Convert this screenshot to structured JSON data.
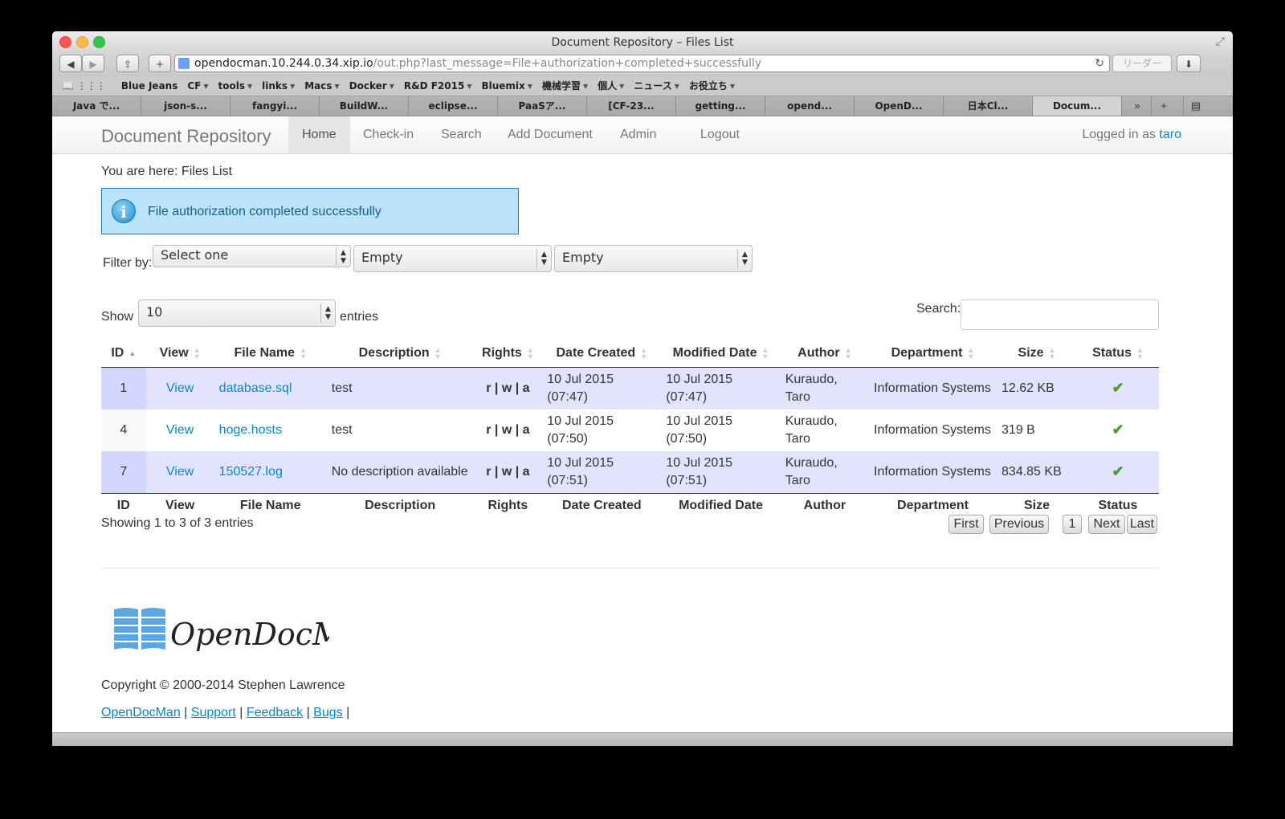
{
  "window": {
    "title": "Document Repository – Files List"
  },
  "toolbar": {
    "url_host": "opendocman.10.244.0.34.xip.io",
    "url_path": "/out.php?last_message=File+authorization+completed+successfully",
    "reader_label": "リーダー"
  },
  "bookmarks": [
    {
      "label": "Blue Jeans",
      "menu": false
    },
    {
      "label": "CF",
      "menu": true
    },
    {
      "label": "tools",
      "menu": true
    },
    {
      "label": "links",
      "menu": true
    },
    {
      "label": "Macs",
      "menu": true
    },
    {
      "label": "Docker",
      "menu": true
    },
    {
      "label": "R&D F2015",
      "menu": true
    },
    {
      "label": "Bluemix",
      "menu": true
    },
    {
      "label": "機械学習",
      "menu": true
    },
    {
      "label": "個人",
      "menu": true
    },
    {
      "label": "ニュース",
      "menu": true
    },
    {
      "label": "お役立ち",
      "menu": true
    }
  ],
  "tabs": [
    {
      "label": "Java で..."
    },
    {
      "label": "json-s..."
    },
    {
      "label": "fangyi..."
    },
    {
      "label": "BuildW..."
    },
    {
      "label": "eclipse..."
    },
    {
      "label": "PaaSア..."
    },
    {
      "label": "[CF-23..."
    },
    {
      "label": "getting..."
    },
    {
      "label": "opend..."
    },
    {
      "label": "OpenD..."
    },
    {
      "label": "日本Cl..."
    },
    {
      "label": "Docum..."
    }
  ],
  "nav": {
    "brand": "Document Repository",
    "items": [
      "Home",
      "Check-in",
      "Search",
      "Add Document",
      "Admin",
      "Logout"
    ],
    "logged_in_prefix": "Logged in as",
    "user": "taro"
  },
  "breadcrumb": "You are here: Files List",
  "alert": {
    "message": "File authorization completed successfully"
  },
  "filter": {
    "label": "Filter by:",
    "selects": [
      "Select one",
      "Empty",
      "Empty"
    ]
  },
  "length": {
    "show_label": "Show",
    "value": "10",
    "entries_label": "entries"
  },
  "search": {
    "label": "Search:",
    "value": ""
  },
  "table": {
    "columns": [
      "ID",
      "View",
      "File Name",
      "Description",
      "Rights",
      "Date Created",
      "Modified Date",
      "Author",
      "Department",
      "Size",
      "Status"
    ],
    "rows": [
      {
        "id": "1",
        "view": "View",
        "file": "database.sql",
        "desc": "test",
        "rights": "r | w | a",
        "created": "10 Jul 2015 (07:47)",
        "modified": "10 Jul 2015 (07:47)",
        "author": "Kuraudo, Taro",
        "dept": "Information Systems",
        "size": "12.62 KB",
        "status": "approved"
      },
      {
        "id": "4",
        "view": "View",
        "file": "hoge.hosts",
        "desc": "test",
        "rights": "r | w | a",
        "created": "10 Jul 2015 (07:50)",
        "modified": "10 Jul 2015 (07:50)",
        "author": "Kuraudo, Taro",
        "dept": "Information Systems",
        "size": "319 B",
        "status": "approved"
      },
      {
        "id": "7",
        "view": "View",
        "file": "150527.log",
        "desc": "No description available",
        "rights": "r | w | a",
        "created": "10 Jul 2015 (07:51)",
        "modified": "10 Jul 2015 (07:51)",
        "author": "Kuraudo, Taro",
        "dept": "Information Systems",
        "size": "834.85 KB",
        "status": "approved"
      }
    ]
  },
  "info": "Showing 1 to 3 of 3 entries",
  "pagination": [
    "First",
    "Previous",
    "1",
    "Next",
    "Last"
  ],
  "footer": {
    "logo_text": "OpenDocMan",
    "copyright": "Copyright © 2000-2014 Stephen Lawrence",
    "links": [
      "OpenDocMan",
      "Support",
      "Feedback",
      "Bugs"
    ]
  },
  "colors": {
    "link": "#0088cc",
    "alert_bg": "#b9e3f6",
    "row_highlight": "#e2e4ff",
    "check": "#4a9a2c"
  }
}
